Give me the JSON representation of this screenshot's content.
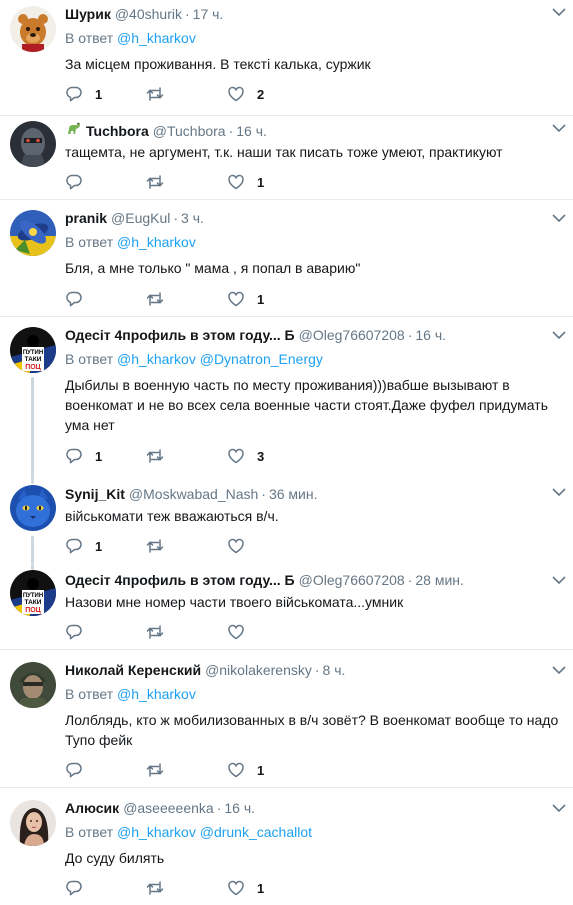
{
  "tweets": [
    {
      "name": "Шурик",
      "handle": "@40shurik",
      "time": "17 ч.",
      "reply_prefix": "В ответ",
      "mentions": [
        "@h_kharkov"
      ],
      "text": "За місцем проживання. В тексті калька, суржик",
      "replies": "1",
      "retweets": "",
      "likes": "2",
      "avatar": "winnie-pooh-avatar"
    },
    {
      "name": "Tuchbora",
      "handle": "@Tuchbora",
      "time": "16 ч.",
      "badge": "dinosaur-emoji-icon",
      "text": "тащемта, не аргумент, т.к. наши так писать тоже умеют, практикуют",
      "replies": "",
      "retweets": "",
      "likes": "1",
      "avatar": "robot-avatar"
    },
    {
      "name": "pranik",
      "handle": "@EugKul",
      "time": "3 ч.",
      "reply_prefix": "В ответ",
      "mentions": [
        "@h_kharkov"
      ],
      "text": "Бля, а мне только \" мама , я попал в аварию\"",
      "replies": "",
      "retweets": "",
      "likes": "1",
      "avatar": "flower-avatar"
    },
    {
      "name": "Одесіт 4профиль в этом году... Б",
      "handle": "@Oleg76607208",
      "time": "16 ч.",
      "reply_prefix": "В ответ",
      "mentions": [
        "@h_kharkov",
        "@Dynatron_Energy"
      ],
      "text": "Дыбилы в военную часть по месту проживания)))вабше вызывают в военкомат и не во всех села военные части стоят.Даже фуфел придумать ума нет",
      "replies": "1",
      "retweets": "",
      "likes": "3",
      "avatar": "putin-poster-avatar",
      "avatar_text": [
        "ПУТИН",
        "ТАКИ",
        "ПОЦ"
      ]
    },
    {
      "name": "Synij_Kit",
      "handle": "@Moskwabad_Nash",
      "time": "36 мин.",
      "text": "військомати теж вважаються в/ч.",
      "replies": "1",
      "retweets": "",
      "likes": "",
      "avatar": "blue-cat-avatar"
    },
    {
      "name": "Одесіт 4профиль в этом году... Б",
      "handle": "@Oleg76607208",
      "time": "28 мин.",
      "text": "Назови мне номер части твоего військомата...умник",
      "replies": "",
      "retweets": "",
      "likes": "",
      "avatar": "putin-poster-avatar",
      "avatar_text": [
        "ПУТИН",
        "ТАКИ",
        "ПОЦ"
      ]
    },
    {
      "name": "Николай Керенский",
      "handle": "@nikolakerensky",
      "time": "8 ч.",
      "reply_prefix": "В ответ",
      "mentions": [
        "@h_kharkov"
      ],
      "text": "Лолблядь, кто ж мобилизованных в в/ч зовёт? В военкомат вообще то надо Тупо фейк",
      "replies": "",
      "retweets": "",
      "likes": "1",
      "avatar": "soldier-avatar"
    },
    {
      "name": "Алюсик",
      "handle": "@aseeeeenka",
      "time": "16 ч.",
      "reply_prefix": "В ответ",
      "mentions": [
        "@h_kharkov",
        "@drunk_cachallot"
      ],
      "text": "До суду билять",
      "replies": "",
      "retweets": "",
      "likes": "1",
      "avatar": "woman-portrait-avatar"
    }
  ],
  "colors": {
    "link": "#1da1f2",
    "secondary": "#657786",
    "text": "#14171a",
    "border": "#e6ecf0",
    "thread": "#ccd6dd"
  }
}
